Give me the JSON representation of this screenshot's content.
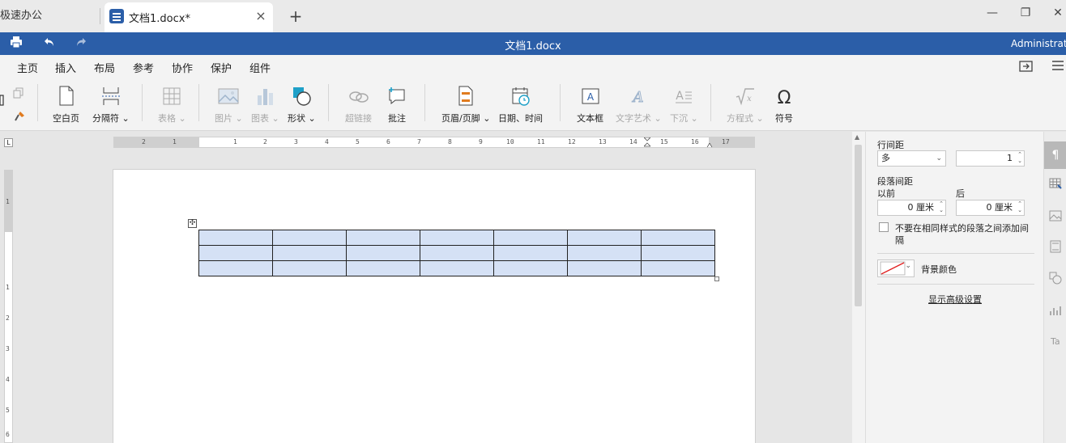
{
  "tabs": {
    "previous": "极速办公",
    "active": "文档1.docx*",
    "close": "×",
    "add": "+"
  },
  "window_controls": {
    "minimize": "—",
    "restore": "❐",
    "close": "✕"
  },
  "titlebar": {
    "title": "文档1.docx",
    "user": "Administrator"
  },
  "menu": [
    "主页",
    "插入",
    "布局",
    "参考",
    "协作",
    "保护",
    "组件"
  ],
  "menu_active": "插入",
  "ribbon": {
    "blank_page": "空白页",
    "separator": "分隔符",
    "table": "表格",
    "image": "图片",
    "chart": "图表",
    "shape": "形状",
    "hyperlink": "超链接",
    "comment": "批注",
    "header_footer": "页眉/页脚",
    "date_time": "日期、时间",
    "textbox": "文本框",
    "text_art": "文字艺术",
    "drop_cap": "下沉",
    "equation": "方程式",
    "symbol": "符号"
  },
  "ruler": {
    "h_labels": [
      "2",
      "1",
      "1",
      "2",
      "3",
      "4",
      "5",
      "6",
      "7",
      "8",
      "9",
      "10",
      "11",
      "12",
      "13",
      "14",
      "15",
      "16",
      "17"
    ],
    "v_labels": [
      "1",
      "1",
      "2",
      "3",
      "4",
      "5",
      "6"
    ]
  },
  "table": {
    "rows": 3,
    "cols": 7
  },
  "panel": {
    "line_spacing_label": "行间距",
    "line_spacing_mode": "多",
    "line_spacing_value": "1",
    "paragraph_spacing_label": "段落间距",
    "before_label": "以前",
    "after_label": "后",
    "before_value": "0 厘米",
    "after_value": "0 厘米",
    "no_space_checkbox": "不要在相同样式的段落之间添加间隔",
    "bg_color_label": "背景颜色",
    "advanced_link": "显示高级设置"
  },
  "colors": {
    "brand": "#2b5ea8",
    "table_fill": "#d5e1f5"
  }
}
